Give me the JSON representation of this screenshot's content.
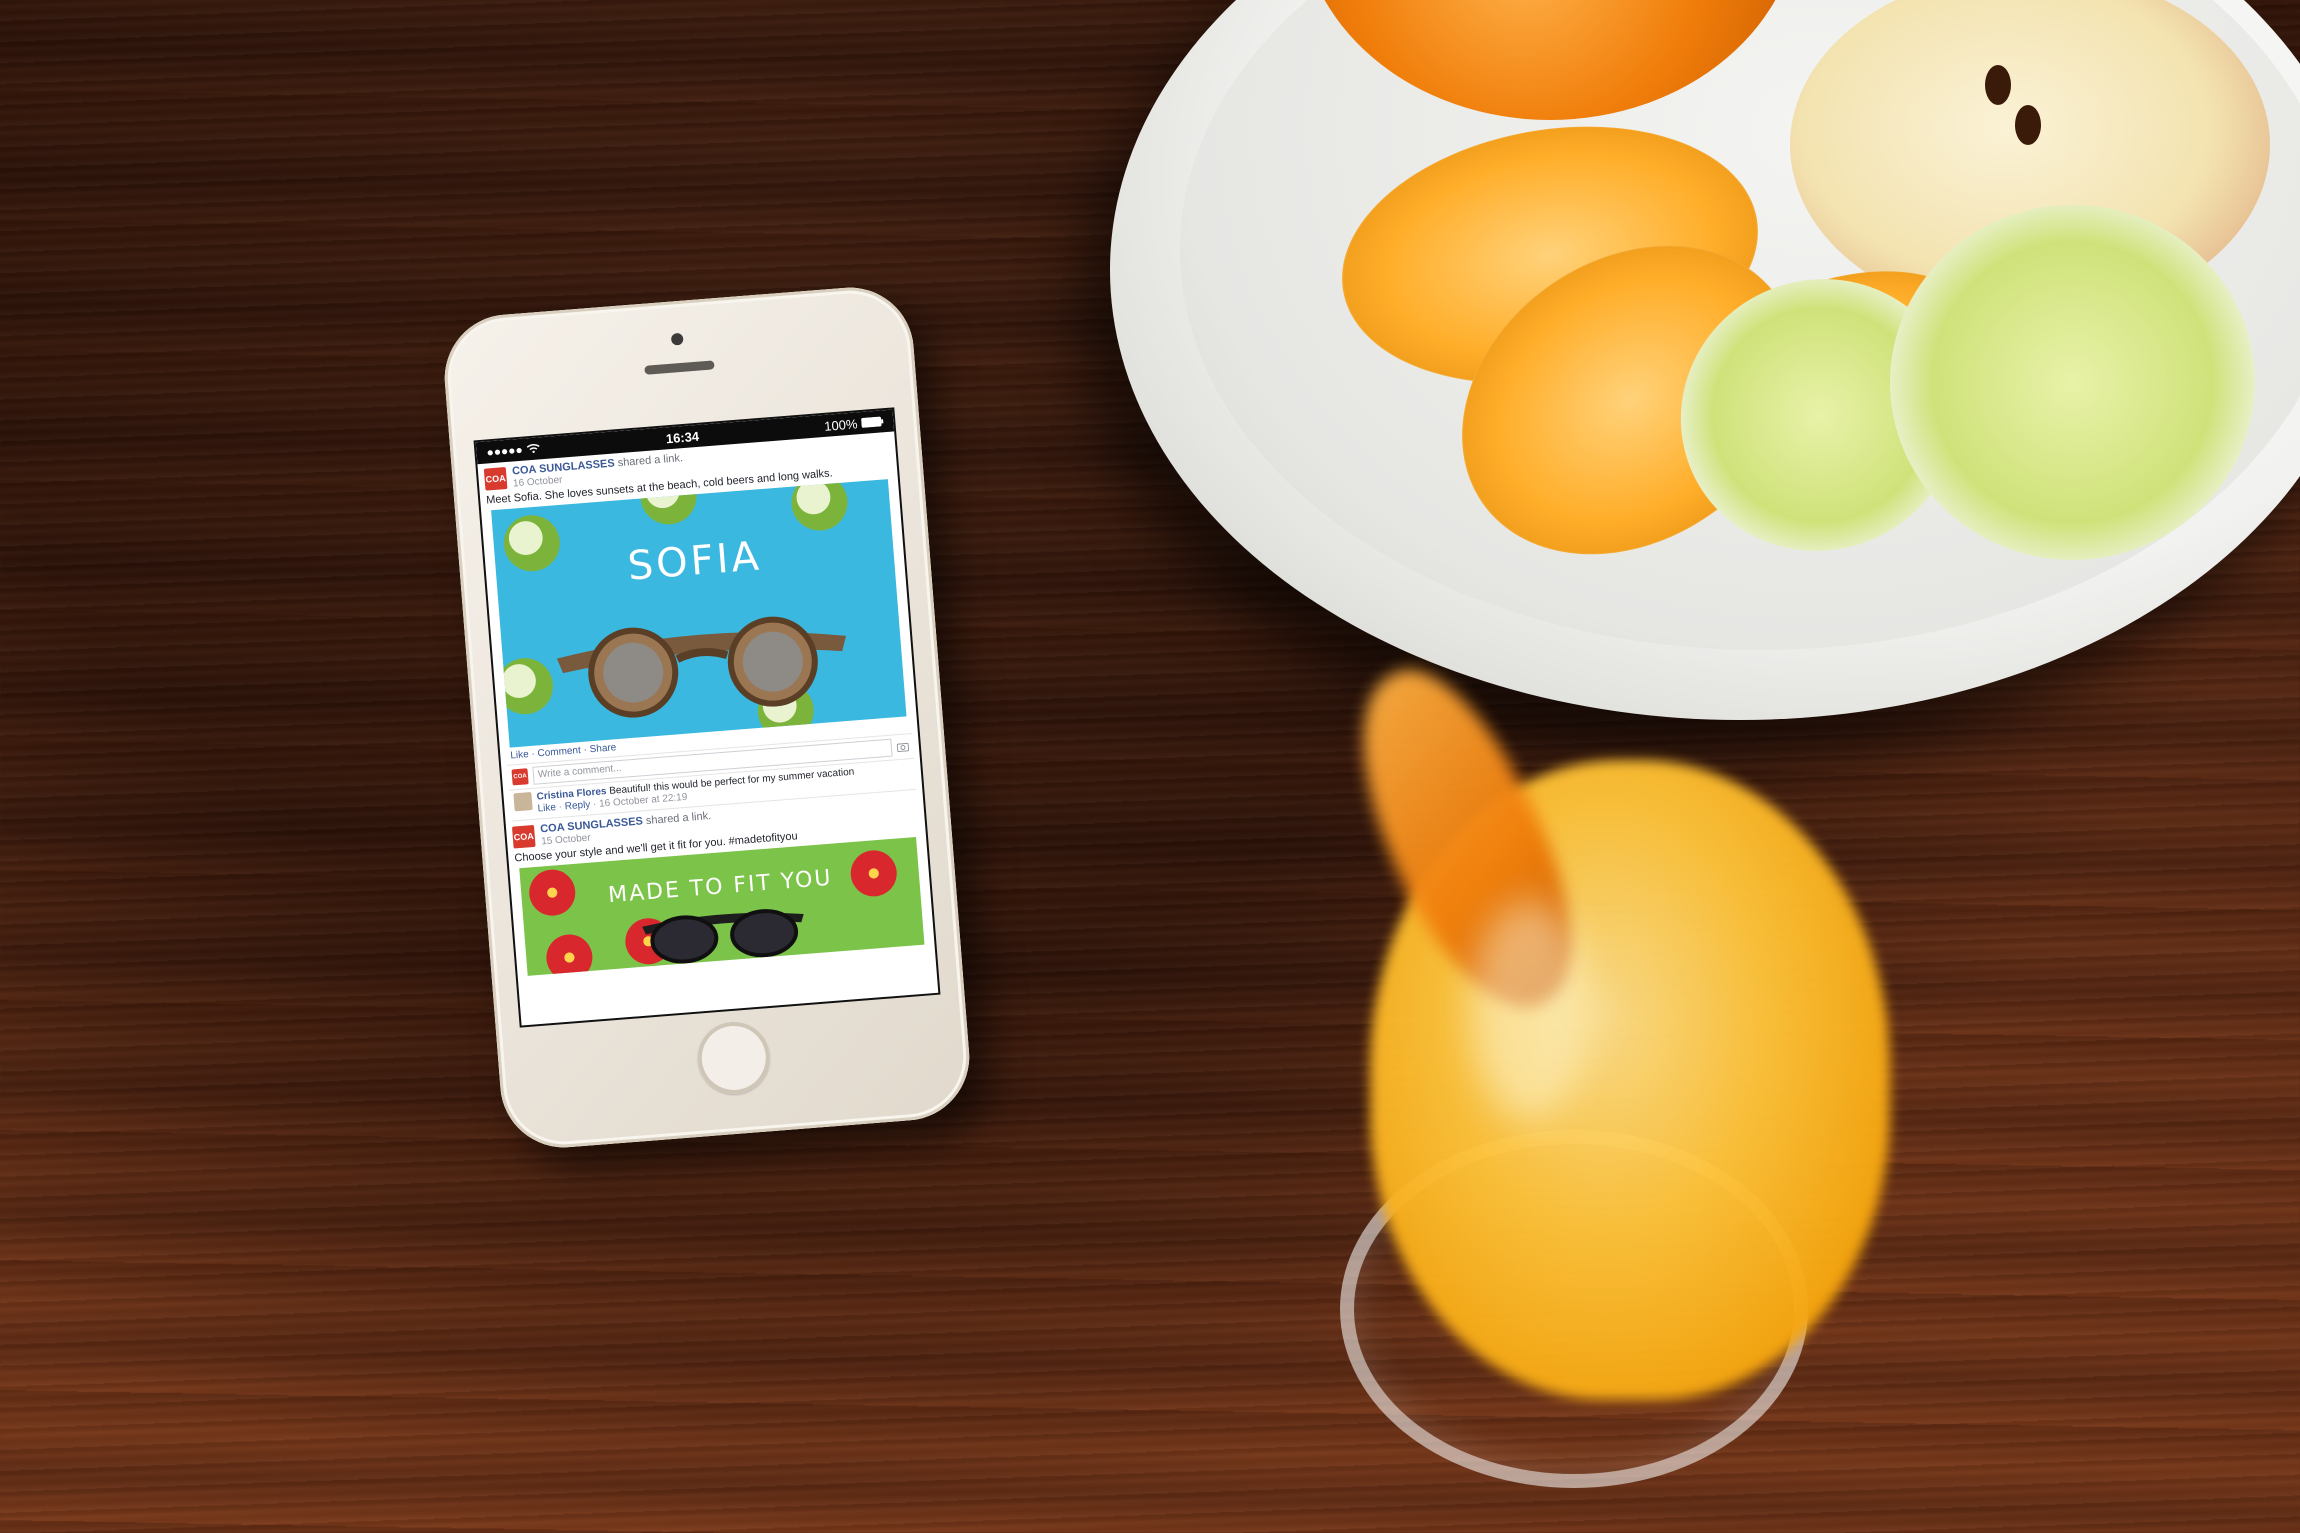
{
  "status_bar": {
    "time": "16:34",
    "battery": "100%"
  },
  "posts": [
    {
      "logo_text": "COA",
      "page_name": "COA SUNGLASSES",
      "action": "shared a link.",
      "date": "16 October",
      "text": "Meet Sofia. She loves sunsets at the beach, cold beers and long walks.",
      "image_title": "SOFIA"
    },
    {
      "logo_text": "COA",
      "page_name": "COA SUNGLASSES",
      "action": "shared a link.",
      "date": "15 October",
      "text": "Choose your style and we'll get it fit for you. #madetofityou",
      "image_title": "MADE TO FIT YOU"
    }
  ],
  "actions": {
    "like": "Like",
    "comment": "Comment",
    "share": "Share"
  },
  "comment_box": {
    "placeholder": "Write a comment..."
  },
  "comment": {
    "author": "Cristina Flores",
    "text": "Beautiful! this would be perfect for my summer vacation",
    "like": "Like",
    "reply": "Reply",
    "timestamp": "16 October at 22:19"
  },
  "colors": {
    "facebook_blue": "#3b5998",
    "brand_red": "#d93a2e",
    "sky_blue": "#3bb8e0",
    "leaf_green": "#7cc34a"
  },
  "icons": [
    "wifi-icon",
    "battery-icon",
    "camera-icon"
  ]
}
